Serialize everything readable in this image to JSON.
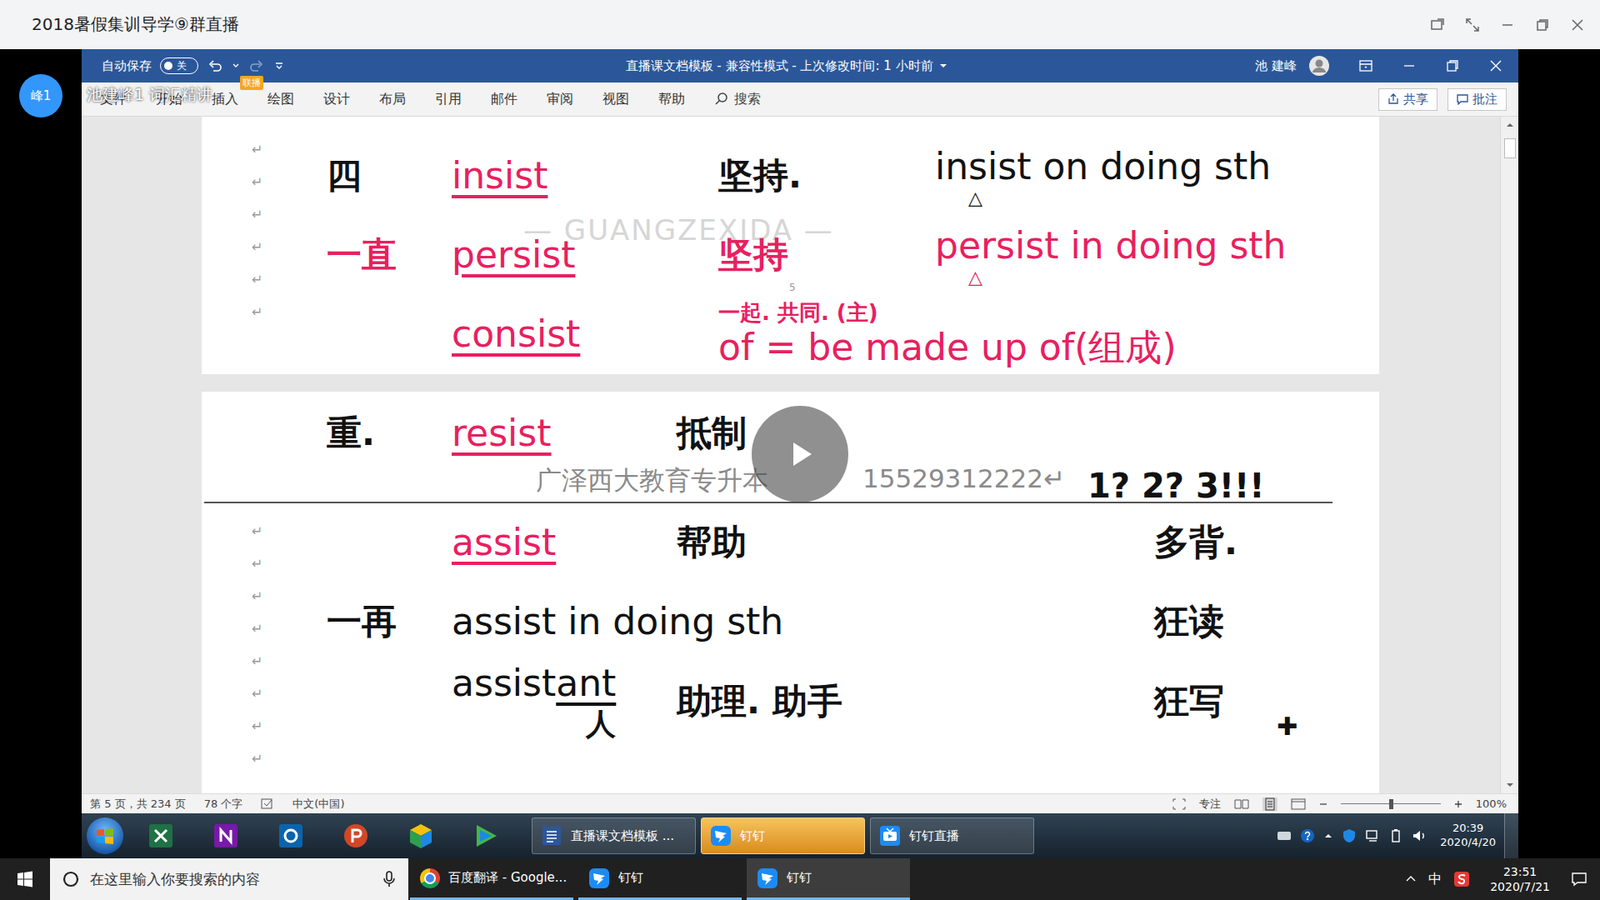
{
  "app": {
    "title": "2018暑假集训导学⑨群直播",
    "avatar": "峰1"
  },
  "stream": {
    "presenter_label": "池建峰1 词汇精讲",
    "badge": "联播",
    "watermark": "广泽西大教育专升本",
    "phone": "15529312222↵",
    "cursor": "✚"
  },
  "word": {
    "autosave_label": "自动保存",
    "autosave_on": false,
    "autosave_state": "关",
    "title": "直播课文档模板 - 兼容性模式 - 上次修改时间: 1 小时前",
    "user": "池 建峰",
    "ribbon_tabs": [
      {
        "label": "文件",
        "selected": false
      },
      {
        "label": "开始",
        "selected": false
      },
      {
        "label": "插入",
        "selected": false
      },
      {
        "label": "绘图",
        "selected": false
      },
      {
        "label": "设计",
        "selected": false
      },
      {
        "label": "布局",
        "selected": false
      },
      {
        "label": "引用",
        "selected": false
      },
      {
        "label": "邮件",
        "selected": false
      },
      {
        "label": "审阅",
        "selected": false
      },
      {
        "label": "视图",
        "selected": false
      },
      {
        "label": "帮助",
        "selected": false
      }
    ],
    "search": "搜索",
    "share": "共享",
    "comment": "批注",
    "status": {
      "page": "第 5 页，共 234 页",
      "words": "78 个字",
      "language": "中文(中国)",
      "focus": "专注",
      "zoom": "100%",
      "zoom_level": 0.5
    }
  },
  "document": {
    "paragraph_mark": "↵",
    "page_number": "5",
    "logo_watermark": "— GUANGZEXIDA —",
    "page_1": {
      "mark_count": 6,
      "rows": [
        {
          "label": "四",
          "label_color": "#111111",
          "word": "insist",
          "color": "#e8205f",
          "underlined": true,
          "meaning": "坚持.",
          "meaning_color": "#111111",
          "phrase": "insist on doing sth",
          "phrase_color": "#111111",
          "mark": "△"
        },
        {
          "label": "一直",
          "label_color": "#e8205f",
          "word": "persist",
          "color": "#e8205f",
          "underlined": true,
          "meaning": "坚持",
          "meaning_color": "#e8205f",
          "phrase": "persist in doing sth",
          "phrase_color": "#e8205f",
          "mark": "△"
        },
        {
          "word": "consist",
          "color": "#e8205f",
          "underlined": true,
          "note": "一起. 共同. (主)",
          "note_color": "#e8205f",
          "phrase": "of = be made up of(组成)",
          "phrase_color": "#e8205f"
        }
      ]
    },
    "page_2": {
      "header": {
        "label": "重.",
        "word": "resist",
        "color": "#e8205f",
        "underlined": true,
        "meaning": "抵制"
      },
      "exclaim": "1? 2? 3!!!",
      "mark_count": 8,
      "rows": [
        {
          "word": "assist",
          "color": "#e8205f",
          "underlined": true,
          "meaning": "帮助",
          "side": "多背."
        },
        {
          "label": "一再",
          "phrase": "assist in doing sth",
          "side": "狂读"
        },
        {
          "word": "assist",
          "suffix": "ant",
          "suffix_note": "人",
          "color": "#111111",
          "underlined": false,
          "meaning": "助理. 助手",
          "side": "狂写"
        }
      ]
    }
  },
  "taskbar_win7": {
    "windows": [
      {
        "label": "直播课文档模板 ...",
        "kind": "word",
        "selected": false
      },
      {
        "label": "钉钉",
        "kind": "dingtalk",
        "selected": true
      },
      {
        "label": "钉钉直播",
        "kind": "live",
        "selected": false
      }
    ],
    "time": "20:39",
    "date": "2020/4/20"
  },
  "taskbar_win10": {
    "search_placeholder": "在这里输入你要搜索的内容",
    "windows": [
      {
        "label": "百度翻译 - Google...",
        "kind": "chrome",
        "selected": false
      },
      {
        "label": "钉钉",
        "kind": "dingtalk",
        "selected": false
      },
      {
        "label": "钉钉",
        "kind": "dingtalk",
        "selected": true
      }
    ],
    "ime": "中",
    "time": "23:51",
    "date": "2020/7/21"
  }
}
